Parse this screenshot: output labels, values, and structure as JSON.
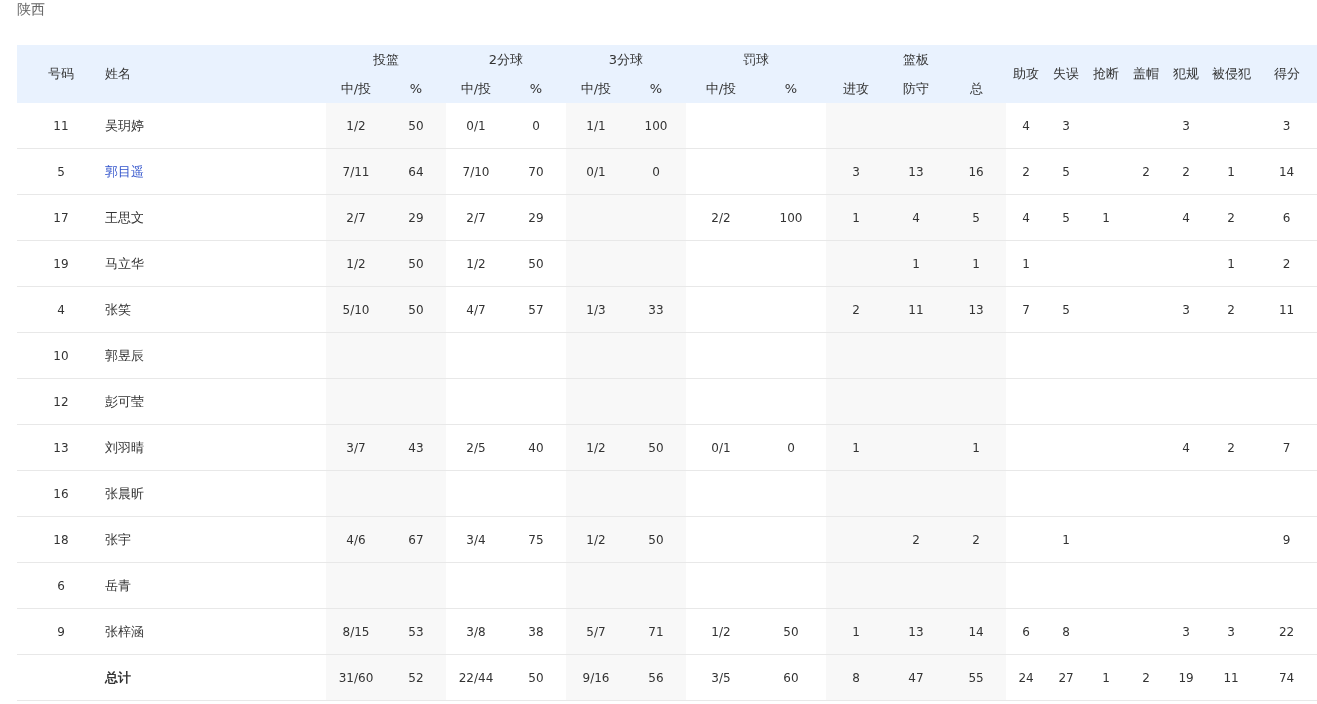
{
  "team": "陕西",
  "columns": [
    {
      "kind": "single",
      "label": "号码"
    },
    {
      "kind": "name",
      "label": "姓名"
    },
    {
      "kind": "group",
      "label": "投篮",
      "sub": [
        "中/投",
        "%"
      ]
    },
    {
      "kind": "group",
      "label": "2分球",
      "sub": [
        "中/投",
        "%"
      ]
    },
    {
      "kind": "group",
      "label": "3分球",
      "sub": [
        "中/投",
        "%"
      ]
    },
    {
      "kind": "group",
      "label": "罚球",
      "sub": [
        "中/投",
        "%"
      ]
    },
    {
      "kind": "group",
      "label": "篮板",
      "sub": [
        "进攻",
        "防守",
        "总"
      ]
    },
    {
      "kind": "single",
      "label": "助攻"
    },
    {
      "kind": "single",
      "label": "失误"
    },
    {
      "kind": "single",
      "label": "抢断"
    },
    {
      "kind": "single",
      "label": "盖帽"
    },
    {
      "kind": "single",
      "label": "犯规"
    },
    {
      "kind": "single",
      "label": "被侵犯"
    },
    {
      "kind": "single",
      "label": "得分"
    }
  ],
  "rows": [
    {
      "number": "11",
      "name": "吴玥婷",
      "linked": false,
      "shooting": {
        "made_attempted": "1/2",
        "percent": "50"
      },
      "two_point": {
        "made_attempted": "0/1",
        "percent": "0"
      },
      "three_point": {
        "made_attempted": "1/1",
        "percent": "100"
      },
      "assists": "4",
      "turnovers": "3",
      "fouls": "3",
      "points": "3"
    },
    {
      "number": "5",
      "name": "郭目遥",
      "linked": true,
      "shooting": {
        "made_attempted": "7/11",
        "percent": "64"
      },
      "two_point": {
        "made_attempted": "7/10",
        "percent": "70"
      },
      "three_point": {
        "made_attempted": "0/1",
        "percent": "0"
      },
      "rebounds": {
        "offensive": "3",
        "defensive": "13",
        "total": "16"
      },
      "assists": "2",
      "turnovers": "5",
      "blocks": "2",
      "fouls": "2",
      "fouls_drawn": "1",
      "points": "14"
    },
    {
      "number": "17",
      "name": "王思文",
      "linked": false,
      "shooting": {
        "made_attempted": "2/7",
        "percent": "29"
      },
      "two_point": {
        "made_attempted": "2/7",
        "percent": "29"
      },
      "free_throws": {
        "made_attempted": "2/2",
        "percent": "100"
      },
      "rebounds": {
        "offensive": "1",
        "defensive": "4",
        "total": "5"
      },
      "assists": "4",
      "turnovers": "5",
      "steals": "1",
      "fouls": "4",
      "fouls_drawn": "2",
      "points": "6"
    },
    {
      "number": "19",
      "name": "马立华",
      "linked": false,
      "shooting": {
        "made_attempted": "1/2",
        "percent": "50"
      },
      "two_point": {
        "made_attempted": "1/2",
        "percent": "50"
      },
      "rebounds": {
        "defensive": "1",
        "total": "1"
      },
      "assists": "1",
      "fouls_drawn": "1",
      "points": "2"
    },
    {
      "number": "4",
      "name": "张笑",
      "linked": false,
      "shooting": {
        "made_attempted": "5/10",
        "percent": "50"
      },
      "two_point": {
        "made_attempted": "4/7",
        "percent": "57"
      },
      "three_point": {
        "made_attempted": "1/3",
        "percent": "33"
      },
      "rebounds": {
        "offensive": "2",
        "defensive": "11",
        "total": "13"
      },
      "assists": "7",
      "turnovers": "5",
      "fouls": "3",
      "fouls_drawn": "2",
      "points": "11"
    },
    {
      "number": "10",
      "name": "郭昱辰",
      "linked": false
    },
    {
      "number": "12",
      "name": "彭可莹",
      "linked": false
    },
    {
      "number": "13",
      "name": "刘羽晴",
      "linked": false,
      "shooting": {
        "made_attempted": "3/7",
        "percent": "43"
      },
      "two_point": {
        "made_attempted": "2/5",
        "percent": "40"
      },
      "three_point": {
        "made_attempted": "1/2",
        "percent": "50"
      },
      "free_throws": {
        "made_attempted": "0/1",
        "percent": "0"
      },
      "rebounds": {
        "offensive": "1",
        "total": "1"
      },
      "fouls": "4",
      "fouls_drawn": "2",
      "points": "7"
    },
    {
      "number": "16",
      "name": "张晨昕",
      "linked": false
    },
    {
      "number": "18",
      "name": "张宇",
      "linked": false,
      "shooting": {
        "made_attempted": "4/6",
        "percent": "67"
      },
      "two_point": {
        "made_attempted": "3/4",
        "percent": "75"
      },
      "three_point": {
        "made_attempted": "1/2",
        "percent": "50"
      },
      "rebounds": {
        "defensive": "2",
        "total": "2"
      },
      "turnovers": "1",
      "points": "9"
    },
    {
      "number": "6",
      "name": "岳青",
      "linked": false
    },
    {
      "number": "9",
      "name": "张梓涵",
      "linked": false,
      "shooting": {
        "made_attempted": "8/15",
        "percent": "53"
      },
      "two_point": {
        "made_attempted": "3/8",
        "percent": "38"
      },
      "three_point": {
        "made_attempted": "5/7",
        "percent": "71"
      },
      "free_throws": {
        "made_attempted": "1/2",
        "percent": "50"
      },
      "rebounds": {
        "offensive": "1",
        "defensive": "13",
        "total": "14"
      },
      "assists": "6",
      "turnovers": "8",
      "fouls": "3",
      "fouls_drawn": "3",
      "points": "22"
    }
  ],
  "total": {
    "label": "总计",
    "shooting": {
      "made_attempted": "31/60",
      "percent": "52"
    },
    "two_point": {
      "made_attempted": "22/44",
      "percent": "50"
    },
    "three_point": {
      "made_attempted": "9/16",
      "percent": "56"
    },
    "free_throws": {
      "made_attempted": "3/5",
      "percent": "60"
    },
    "rebounds": {
      "offensive": "8",
      "defensive": "47",
      "total": "55"
    },
    "assists": "24",
    "turnovers": "27",
    "steals": "1",
    "blocks": "2",
    "fouls": "19",
    "fouls_drawn": "11",
    "points": "74"
  }
}
